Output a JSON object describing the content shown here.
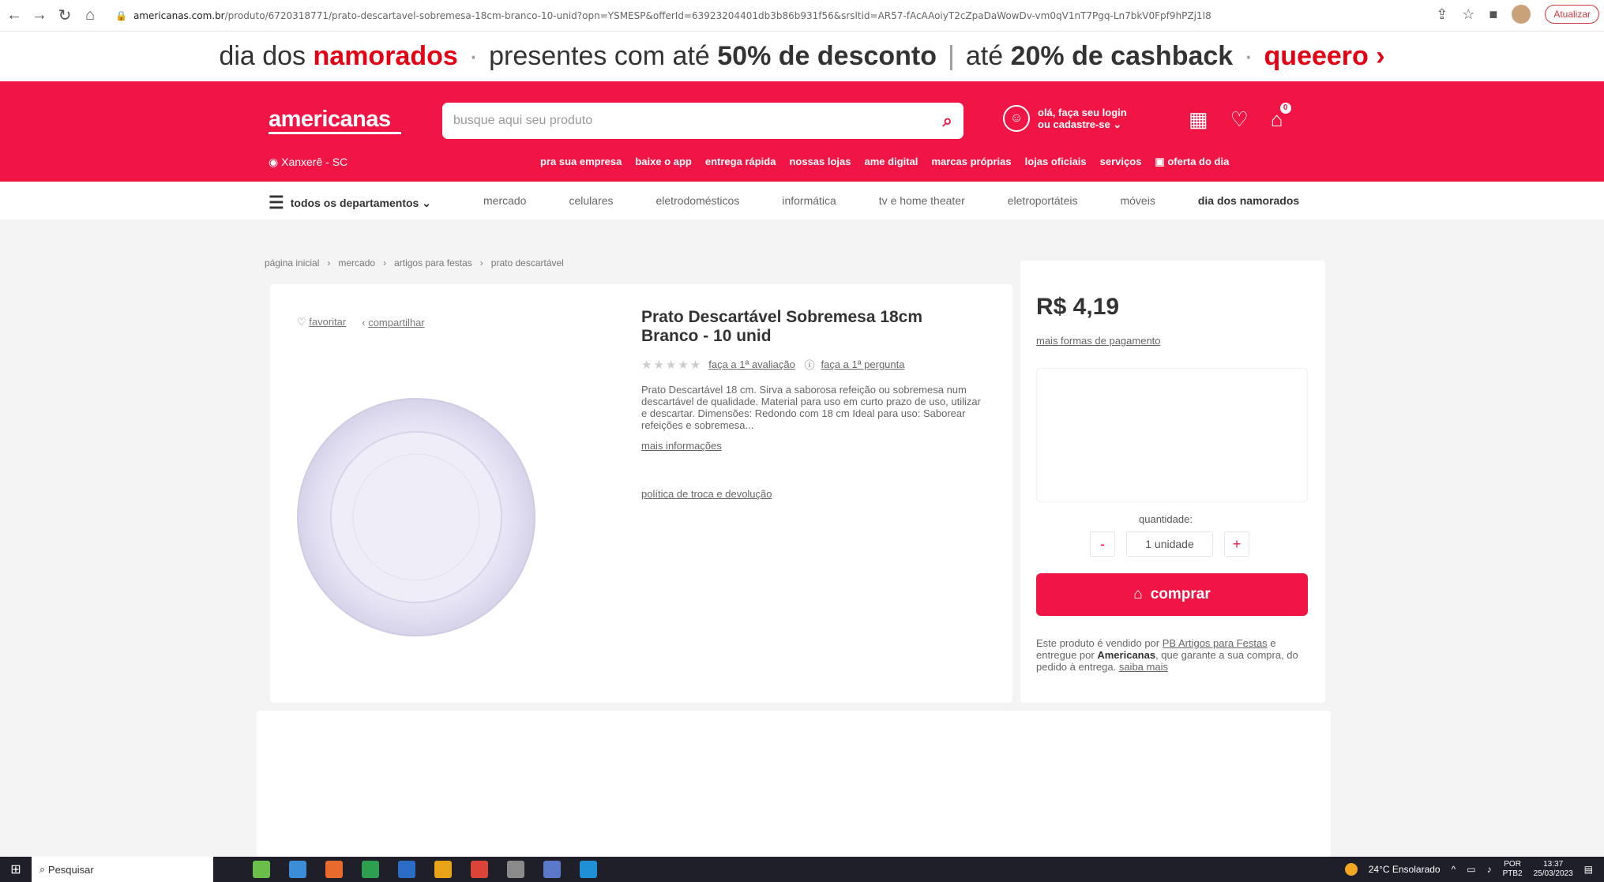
{
  "browser": {
    "url_prefix": "americanas.com.br",
    "url_rest": "/produto/6720318771/prato-descartavel-sobremesa-18cm-branco-10-unid?opn=YSMESP&offerId=63923204401db3b86b931f56&srsltid=AR57-fAcAAoiyT2cZpaDaWowDv-vm0qV1nT7Pgq-Ln7bkV0Fpf9hPZj1I8",
    "update_label": "Atualizar"
  },
  "promo": {
    "part1": "dia dos",
    "part1_bold": "namorados",
    "part2": "presentes com até",
    "part2_bold": "50% de desconto",
    "divider": "|",
    "part3": "até",
    "part3_bold": "20% de cashback",
    "cta": "queeero ›"
  },
  "header": {
    "logo": "americanas",
    "search_placeholder": "busque aqui seu produto",
    "login_line1": "olá, faça seu login",
    "login_line2": "ou cadastre-se ⌄",
    "cart_count": "0",
    "location": "Xanxerê - SC",
    "sub_links": [
      "pra sua empresa",
      "baixe o app",
      "entrega rápida",
      "nossas lojas",
      "ame digital",
      "marcas próprias",
      "lojas oficiais",
      "serviços",
      "oferta do dia"
    ]
  },
  "departments": {
    "menu_label": "todos os departamentos",
    "items": [
      "mercado",
      "celulares",
      "eletrodomésticos",
      "informática",
      "tv e home theater",
      "eletroportáteis",
      "móveis",
      "dia dos namorados"
    ]
  },
  "breadcrumb": [
    "página inicial",
    "mercado",
    "artigos para festas",
    "prato descartável"
  ],
  "product": {
    "favorite": "favoritar",
    "share": "compartilhar",
    "title": "Prato Descartável Sobremesa 18cm Branco - 10 unid",
    "rate_link": "faça a 1ª avaliação",
    "ask_link": "faça a 1ª pergunta",
    "description": "Prato Descartável 18 cm. Sirva a saborosa refeição ou sobremesa num descartável de qualidade. Material para uso em curto prazo de uso, utilizar e descartar. Dimensões: Redondo com 18 cm Ideal para uso: Saborear refeições e sobremesa...",
    "more_info": "mais informações",
    "policy": "política de troca e devolução"
  },
  "buybox": {
    "price": "R$ 4,19",
    "payment_forms": "mais formas de pagamento",
    "qty_label": "quantidade:",
    "qty_value": "1 unidade",
    "minus": "-",
    "plus": "+",
    "buy_label": "comprar",
    "seller_pre": "Este produto é vendido por",
    "seller_name": "PB Artigos para Festas",
    "seller_mid": "e entregue por",
    "seller_delivery": "Americanas",
    "seller_post": ", que garante a sua compra, do pedido à entrega.",
    "seller_more": "saiba mais"
  },
  "taskbar": {
    "search_placeholder": "Pesquisar",
    "weather": "24°C Ensolarado",
    "lang_line1": "POR",
    "lang_line2": "PTB2",
    "time": "13:37",
    "date": "25/03/2023"
  },
  "colors": {
    "brand": "#f01545",
    "promo_red": "#e60014"
  }
}
